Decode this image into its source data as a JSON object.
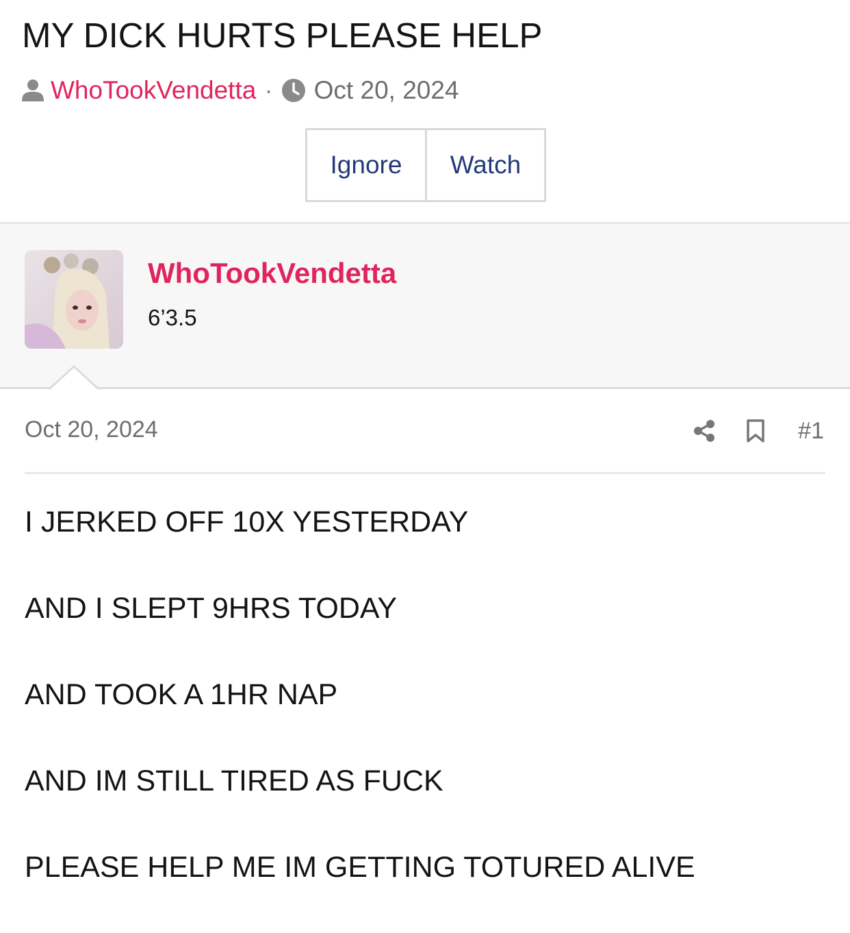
{
  "thread": {
    "title": "MY DICK HURTS PLEASE HELP",
    "author": "WhoTookVendetta",
    "separator": "·",
    "date": "Oct 20, 2024"
  },
  "actions": {
    "ignore_label": "Ignore",
    "watch_label": "Watch"
  },
  "post": {
    "user": {
      "name": "WhoTookVendetta",
      "title": "6’3.5"
    },
    "date": "Oct 20, 2024",
    "number": "#1",
    "lines": [
      "I JERKED OFF 10X YESTERDAY",
      "AND I SLEPT 9HRS TODAY",
      "AND TOOK A 1HR NAP",
      "AND IM STILL TIRED AS FUCK",
      "PLEASE HELP ME IM GETTING TOTURED ALIVE"
    ]
  },
  "icons": {
    "author": "user-icon",
    "date": "clock-icon",
    "share": "share-icon",
    "bookmark": "bookmark-icon"
  },
  "colors": {
    "link": "#e0245e",
    "button_text": "#233a7a",
    "muted": "#6e6e6e"
  }
}
